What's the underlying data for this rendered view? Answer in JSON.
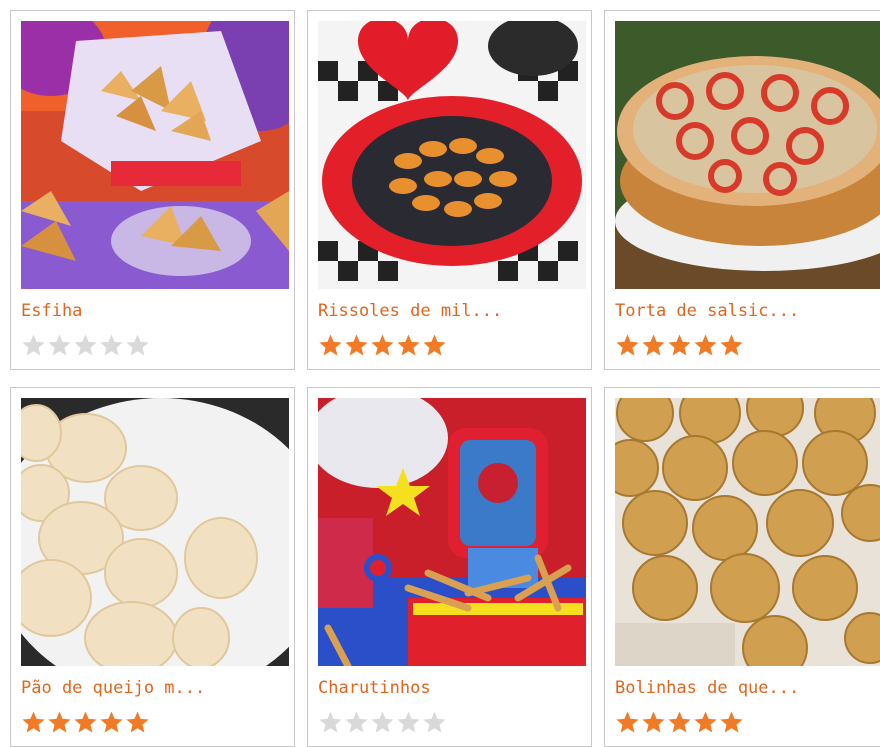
{
  "recipes": [
    {
      "title": "Esfiha",
      "rating": 0,
      "max_rating": 5
    },
    {
      "title": "Rissoles de mil...",
      "rating": 5,
      "max_rating": 5
    },
    {
      "title": "Torta de salsic...",
      "rating": 5,
      "max_rating": 5
    },
    {
      "title": "Pão de queijo m...",
      "rating": 5,
      "max_rating": 5
    },
    {
      "title": "Charutinhos",
      "rating": 0,
      "max_rating": 5
    },
    {
      "title": "Bolinhas de que...",
      "rating": 5,
      "max_rating": 5
    }
  ],
  "colors": {
    "title": "#e0661e",
    "star_on": "#f07a26",
    "star_off": "#d9d9d9",
    "card_border": "#c9c9c9"
  }
}
